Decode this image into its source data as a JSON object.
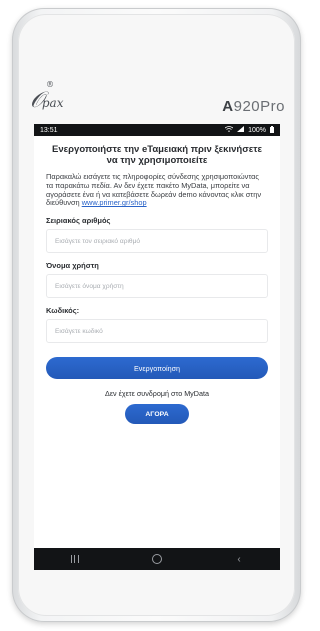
{
  "device": {
    "brand": "pax",
    "model_prefix": "A",
    "model_rest": "920Pro"
  },
  "status_bar": {
    "time": "13:51",
    "battery": "100%"
  },
  "screen": {
    "title": "Ενεργοποιήστε την eΤαμειακή πριν ξεκινήσετε να την χρησιμοποιείτε",
    "description": "Παρακαλώ εισάγετε τις πληροφορίες σύνδεσης χρησιμοποιώντας τα παρακάτω πεδία. Αν δεν έχετε πακέτο MyData, μπορείτε να αγοράσετε ένα ή να κατεβάσετε δωρεάν demo κάνοντας κλικ στην διεύθυνση",
    "link": "www.primer.gr/shop",
    "fields": {
      "serial": {
        "label": "Σειριακός αριθμός",
        "placeholder": "Εισάγετε τον σειριακό αριθμό",
        "value": ""
      },
      "username": {
        "label": "Όνομα χρήστη",
        "placeholder": "Εισάγετε όνομα χρήστη",
        "value": ""
      },
      "password": {
        "label": "Κωδικός:",
        "placeholder": "Εισάγετε κωδικό",
        "value": ""
      }
    },
    "activate_label": "Ενεργοποίηση",
    "mydata_text": "Δεν έχετε συνδρομή στο MyData",
    "buy_label": "ΑΓΟΡΑ"
  },
  "colors": {
    "accent": "#2a63c8",
    "status_bar": "#121416"
  },
  "icons": {
    "status": [
      "wifi-icon",
      "signal-icon",
      "battery-icon"
    ],
    "nav": [
      "recents-icon",
      "home-icon",
      "back-icon"
    ]
  }
}
